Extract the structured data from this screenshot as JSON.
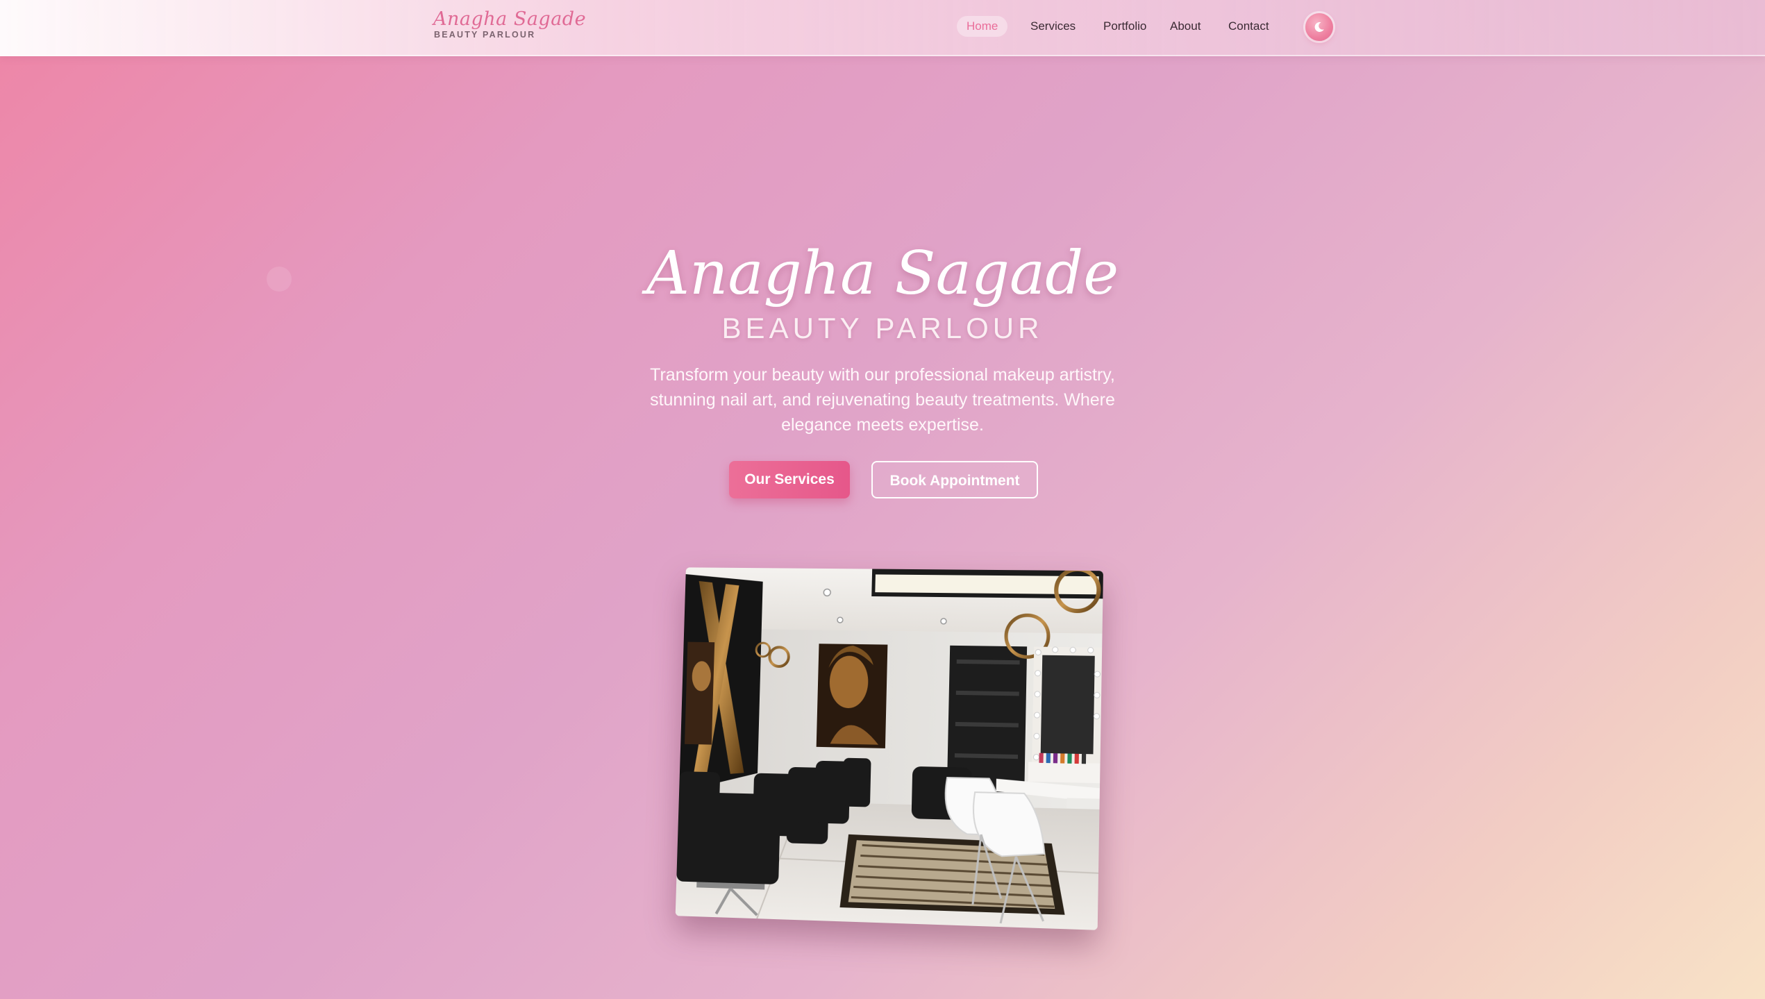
{
  "brand": {
    "name": "Anagha Sagade",
    "tagline": "BEAUTY PARLOUR"
  },
  "nav": {
    "items": [
      {
        "label": "Home",
        "active": true
      },
      {
        "label": "Services",
        "active": false
      },
      {
        "label": "Portfolio",
        "active": false
      },
      {
        "label": "About",
        "active": false
      },
      {
        "label": "Contact",
        "active": false
      }
    ],
    "theme_toggle_icon": "moon-icon"
  },
  "hero": {
    "title": "Anagha Sagade",
    "subtitle": "BEAUTY PARLOUR",
    "description": "Transform your beauty with our professional makeup artistry, stunning nail art, and rejuvenating beauty treatments. Where elegance meets expertise.",
    "primary_button": "Our Services",
    "secondary_button": "Book Appointment",
    "image_icon": "salon-interior-photo"
  },
  "colors": {
    "accent": "#e6578a",
    "nav_active": "#ea6e9a",
    "gradient_start": "#ee85a6",
    "gradient_end": "#f8e2c6"
  }
}
